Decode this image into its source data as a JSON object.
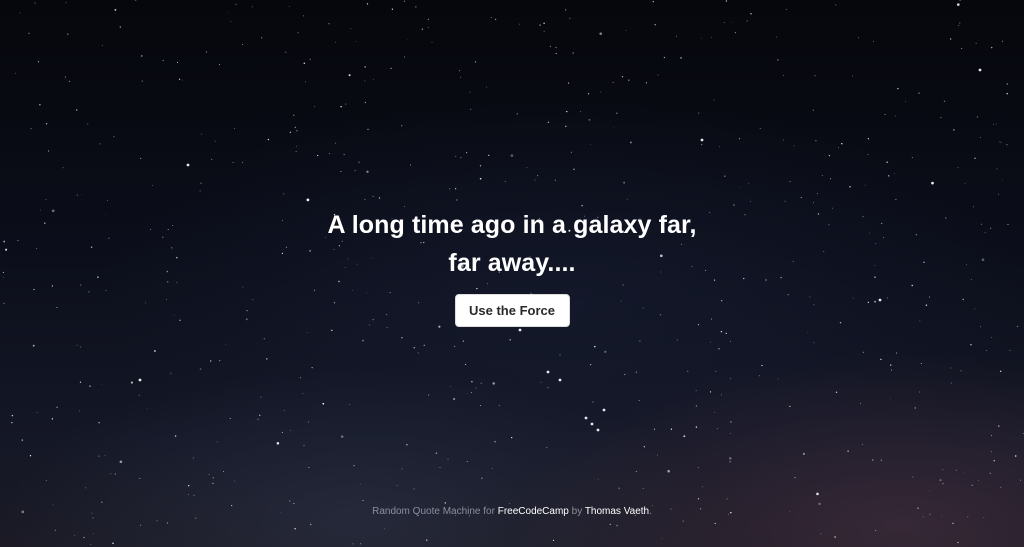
{
  "quote": {
    "line1": "A long time ago in a galaxy far,",
    "line2": "far away...."
  },
  "button": {
    "label": "Use the Force"
  },
  "footer": {
    "prefix": "Random Quote Machine for ",
    "link1": "FreeCodeCamp",
    "middle": " by ",
    "link2": "Thomas Vaeth",
    "suffix": "."
  },
  "colors": {
    "text": "#ffffff",
    "footer_text": "#8a8f9c",
    "button_bg": "#ffffff",
    "button_text": "#2a2a2a"
  }
}
